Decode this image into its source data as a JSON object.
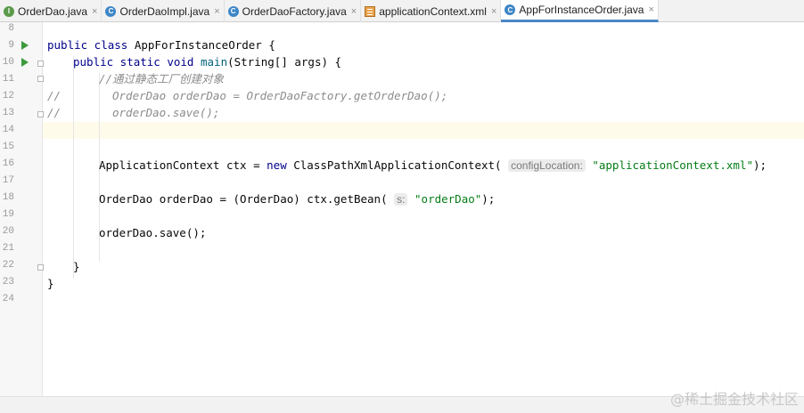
{
  "tabs": [
    {
      "label": "OrderDao.java",
      "icon": "I",
      "icon_color": "#5b9a4a"
    },
    {
      "label": "OrderDaoImpl.java",
      "icon": "C",
      "icon_color": "#3e86c6"
    },
    {
      "label": "OrderDaoFactory.java",
      "icon": "C",
      "icon_color": "#3e86c6"
    },
    {
      "label": "applicationContext.xml",
      "icon": "xml-file-icon",
      "icon_color": "#e8a24a"
    },
    {
      "label": "AppForInstanceOrder.java",
      "icon": "C",
      "icon_color": "#3e86c6",
      "active": true
    }
  ],
  "tab_close_glyph": "×",
  "line_numbers": [
    "8",
    "9",
    "10",
    "11",
    "12",
    "13",
    "14",
    "15",
    "16",
    "17",
    "18",
    "19",
    "20",
    "21",
    "22",
    "23",
    "24"
  ],
  "code": {
    "l9_kw": "public class ",
    "l9_name": "AppForInstanceOrder {",
    "l10_kw": "public static void ",
    "l10_fn": "main",
    "l10_rest": "(String[] args) {",
    "l11_comment": "//通过静态工厂创建对象",
    "l12_slash": "//",
    "l12_comment": "OrderDao orderDao = OrderDaoFactory.getOrderDao();",
    "l13_slash": "//",
    "l13_comment": "orderDao.save();",
    "l16_a": "ApplicationContext ctx = ",
    "l16_new": "new",
    "l16_b": " ClassPathXmlApplicationContext(",
    "l16_hint": "configLocation:",
    "l16_str": "\"applicationContext.xml\"",
    "l16_end": ");",
    "l18_a": "OrderDao orderDao = (OrderDao) ctx.getBean(",
    "l18_hint": "s:",
    "l18_str": "\"orderDao\"",
    "l18_end": ");",
    "l20": "orderDao.save();",
    "l22": "}",
    "l23": "}"
  },
  "watermark": "@稀土掘金技术社区",
  "colors": {
    "keyword": "#00008b",
    "string": "#067d17",
    "comment": "#8c8c8c",
    "accent": "#4a88c7"
  }
}
